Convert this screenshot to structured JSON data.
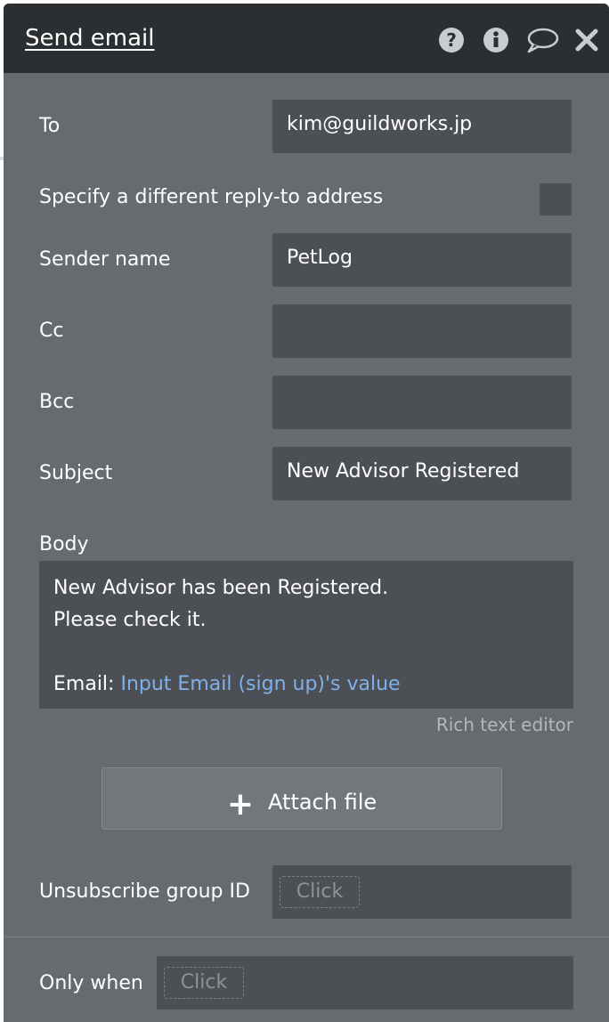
{
  "header": {
    "title": "Send email",
    "icons": [
      "help-icon",
      "info-icon",
      "comment-icon",
      "close-icon"
    ]
  },
  "fields": {
    "to": {
      "label": "To",
      "value": "kim@guildworks.jp"
    },
    "reply_to": {
      "label": "Specify a different reply-to address",
      "checked": false
    },
    "sender_name": {
      "label": "Sender name",
      "value": "PetLog"
    },
    "cc": {
      "label": "Cc",
      "value": ""
    },
    "bcc": {
      "label": "Bcc",
      "value": ""
    },
    "subject": {
      "label": "Subject",
      "value": "New Advisor Registered"
    }
  },
  "body": {
    "label": "Body",
    "line1": "New Advisor has been Registered.",
    "line2": "Please check it.",
    "email_prefix": "Email: ",
    "email_expression": "Input Email (sign up)'s value",
    "rich_text_label": "Rich text editor"
  },
  "attach": {
    "label": "Attach file"
  },
  "unsubscribe": {
    "label": "Unsubscribe group ID",
    "placeholder": "Click"
  },
  "only_when": {
    "label": "Only when",
    "placeholder": "Click"
  }
}
